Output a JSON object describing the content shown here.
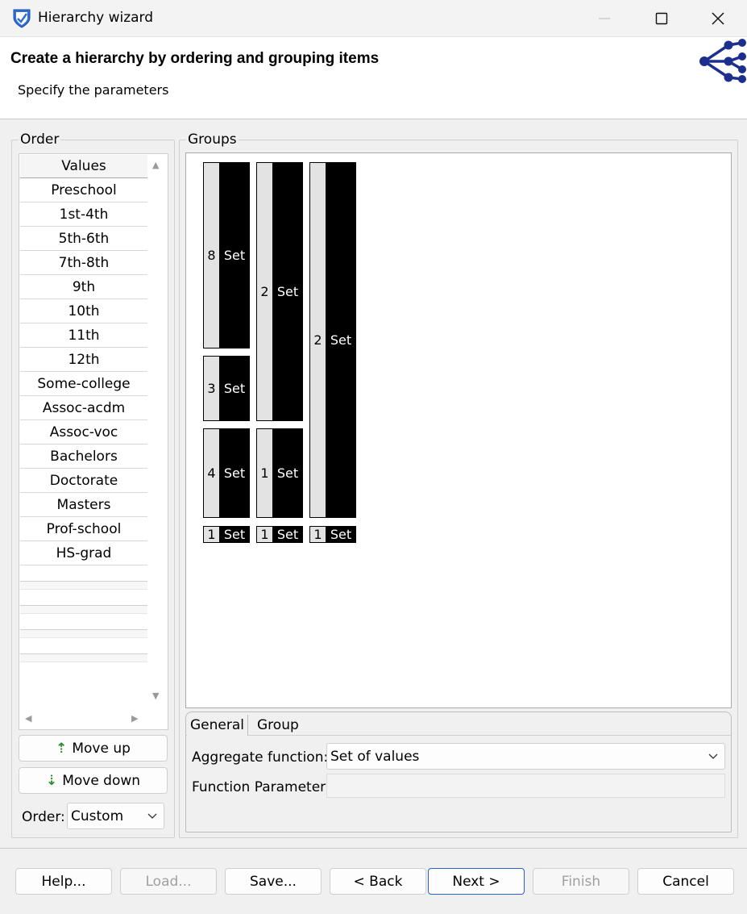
{
  "window": {
    "title": "Hierarchy wizard"
  },
  "header": {
    "title": "Create a hierarchy by ordering and grouping items",
    "subtitle": "Specify the parameters"
  },
  "order": {
    "label": "Order",
    "column_header": "Values",
    "items": [
      "Preschool",
      "1st-4th",
      "5th-6th",
      "7th-8th",
      "9th",
      "10th",
      "11th",
      "12th",
      "Some-college",
      "Assoc-acdm",
      "Assoc-voc",
      "Bachelors",
      "Doctorate",
      "Masters",
      "Prof-school",
      "HS-grad"
    ],
    "move_up_label": "Move up",
    "move_down_label": "Move down",
    "order_label": "Order:",
    "order_value": "Custom"
  },
  "groups": {
    "label": "Groups",
    "set_label": "Set",
    "columns": [
      [
        {
          "count": "8"
        },
        {
          "count": "3"
        },
        {
          "count": "4"
        },
        {
          "count": "1"
        }
      ],
      [
        {
          "count": "2"
        },
        {
          "count": "1"
        },
        {
          "count": "1"
        }
      ],
      [
        {
          "count": "2"
        },
        {
          "count": "1"
        }
      ]
    ]
  },
  "tabs": {
    "general": "General",
    "group": "Group",
    "aggregate_label": "Aggregate function:",
    "aggregate_value": "Set of values",
    "param_label": "Function Parameter:",
    "param_value": ""
  },
  "footer": {
    "help": "Help...",
    "load": "Load...",
    "save": "Save...",
    "back": "< Back",
    "next": "Next >",
    "finish": "Finish",
    "cancel": "Cancel"
  }
}
